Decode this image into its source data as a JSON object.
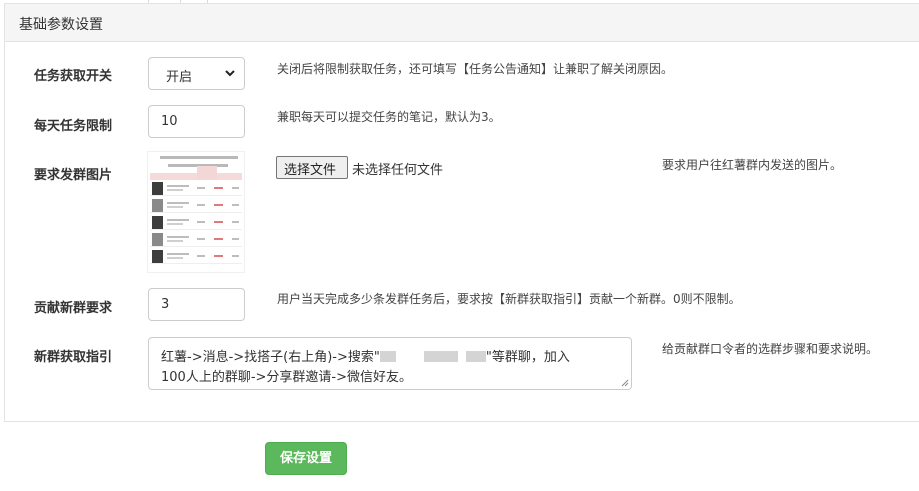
{
  "panel": {
    "title": "基础参数设置"
  },
  "fields": {
    "task_switch": {
      "label": "任务获取开关",
      "value": "开启",
      "help": "关闭后将限制获取任务，还可填写【任务公告通知】让兼职了解关闭原因。"
    },
    "daily_limit": {
      "label": "每天任务限制",
      "value": "10",
      "help": "兼职每天可以提交任务的笔记，默认为3。"
    },
    "group_image": {
      "label": "要求发群图片",
      "file_button": "选择文件",
      "file_status": "未选择任何文件",
      "help": "要求用户往红薯群内发送的图片。"
    },
    "new_group_requirement": {
      "label": "贡献新群要求",
      "value": "3",
      "help": "用户当天完成多少条发群任务后，要求按【新群获取指引】贡献一个新群。0则不限制。"
    },
    "new_group_guide": {
      "label": "新群获取指引",
      "value_line1_prefix": "红薯->消息->找搭子(右上角)->搜索\"",
      "value_line1_suffix": "\"等群聊，加入",
      "value_line2": "100人上的群聊->分享群邀请->微信好友。",
      "help": "给贡献群口令者的选群步骤和要求说明。"
    }
  },
  "actions": {
    "save_label": "保存设置",
    "save_color": "#5cb85c"
  }
}
